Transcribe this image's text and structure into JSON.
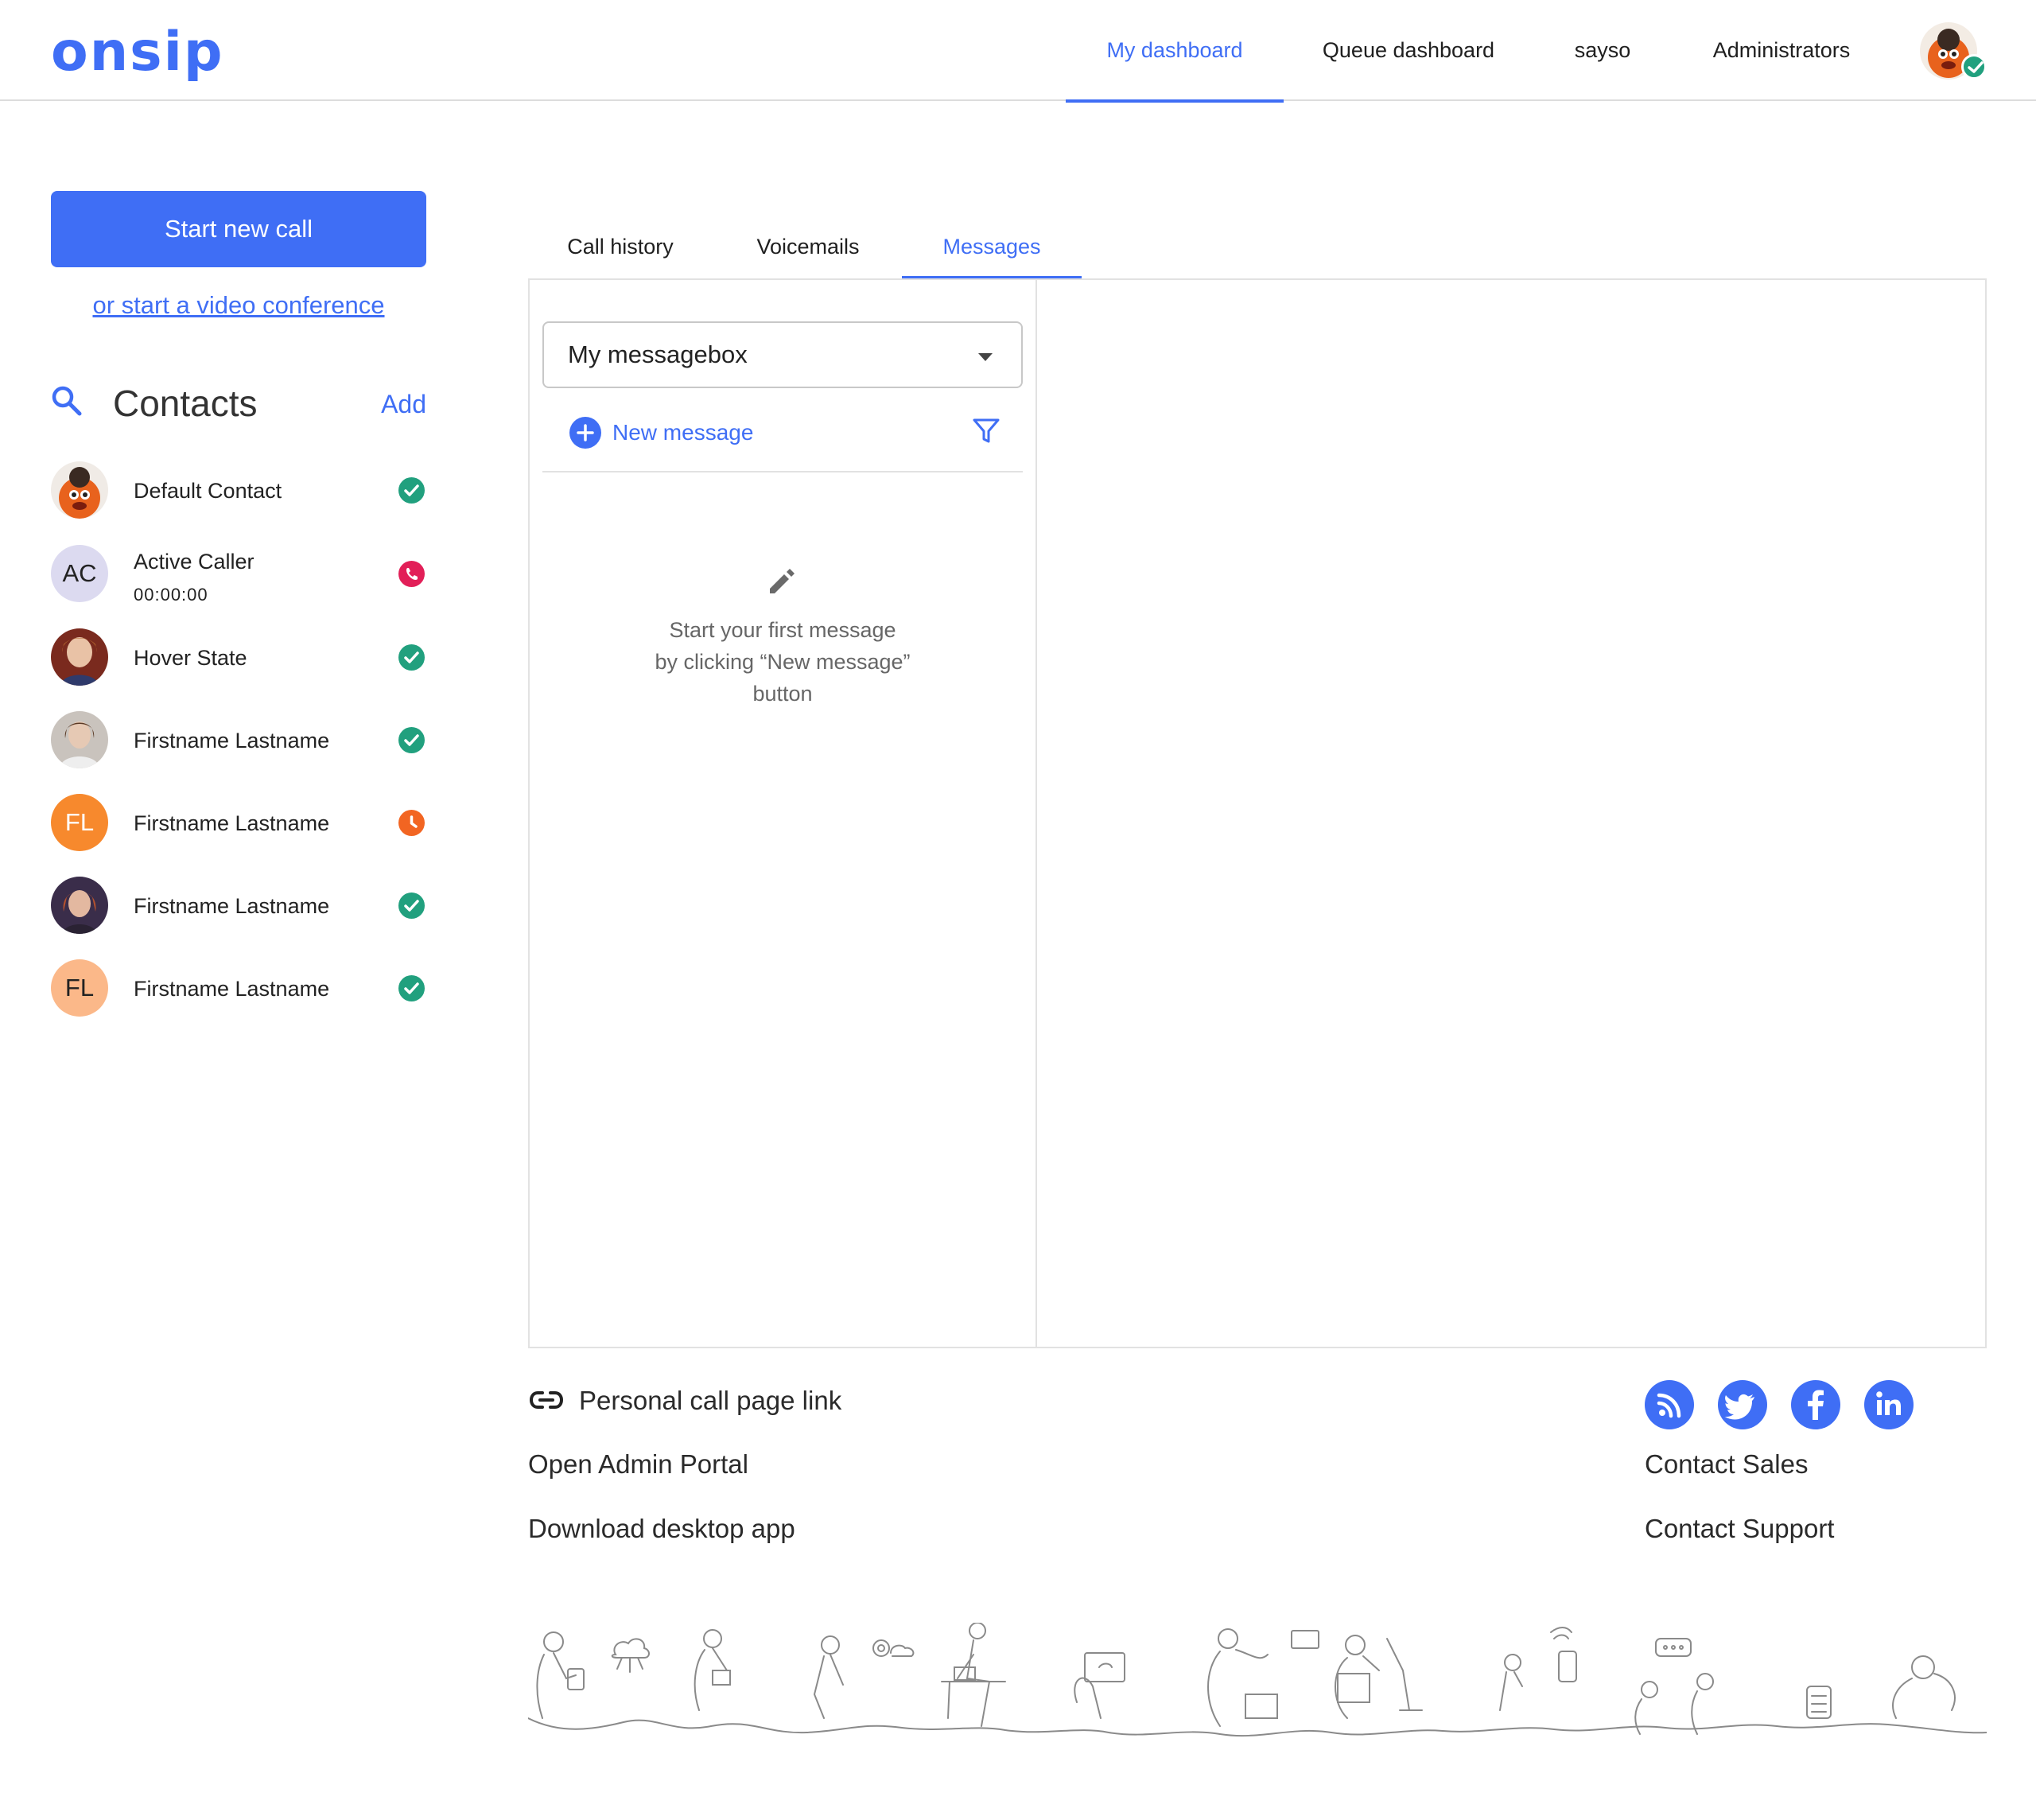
{
  "header": {
    "logo": "onsip",
    "nav": [
      {
        "label": "My dashboard",
        "active": true
      },
      {
        "label": "Queue dashboard",
        "active": false
      },
      {
        "label": "sayso",
        "active": false
      },
      {
        "label": "Administrators",
        "active": false
      }
    ],
    "user_status": "available"
  },
  "sidebar": {
    "start_call_label": "Start new call",
    "video_link_label": "or start a video conference",
    "contacts_title": "Contacts",
    "add_label": "Add",
    "contacts": [
      {
        "name": "Default Contact",
        "initials": "",
        "avatar": "mascot",
        "status": "available"
      },
      {
        "name": "Active Caller",
        "sub": "00:00:00",
        "initials": "AC",
        "avatar": "initials",
        "status": "oncall"
      },
      {
        "name": "Hover State",
        "initials": "",
        "avatar": "photo",
        "status": "available"
      },
      {
        "name": "Firstname Lastname",
        "initials": "",
        "avatar": "photo",
        "status": "available"
      },
      {
        "name": "Firstname Lastname",
        "initials": "FL",
        "avatar": "initials",
        "status": "away"
      },
      {
        "name": "Firstname Lastname",
        "initials": "",
        "avatar": "photo",
        "status": "available"
      },
      {
        "name": "Firstname Lastname",
        "initials": "FL",
        "avatar": "initials",
        "status": "available"
      }
    ]
  },
  "tabs": [
    {
      "label": "Call history",
      "active": false
    },
    {
      "label": "Voicemails",
      "active": false
    },
    {
      "label": "Messages",
      "active": true
    }
  ],
  "messages": {
    "messagebox_selected": "My messagebox",
    "new_message_label": "New message",
    "empty_line1": "Start your first message",
    "empty_line2": "by clicking “New message”",
    "empty_line3": "button"
  },
  "footer": {
    "personal_link": "Personal call page link",
    "admin_portal": "Open Admin Portal",
    "download_app": "Download desktop app",
    "contact_sales": "Contact Sales",
    "contact_support": "Contact Support",
    "social": [
      "rss-icon",
      "twitter-icon",
      "facebook-icon",
      "linkedin-icon"
    ]
  },
  "colors": {
    "accent": "#3f6ef5",
    "available": "#21a07e",
    "oncall": "#e21f58",
    "away": "#f26522"
  }
}
